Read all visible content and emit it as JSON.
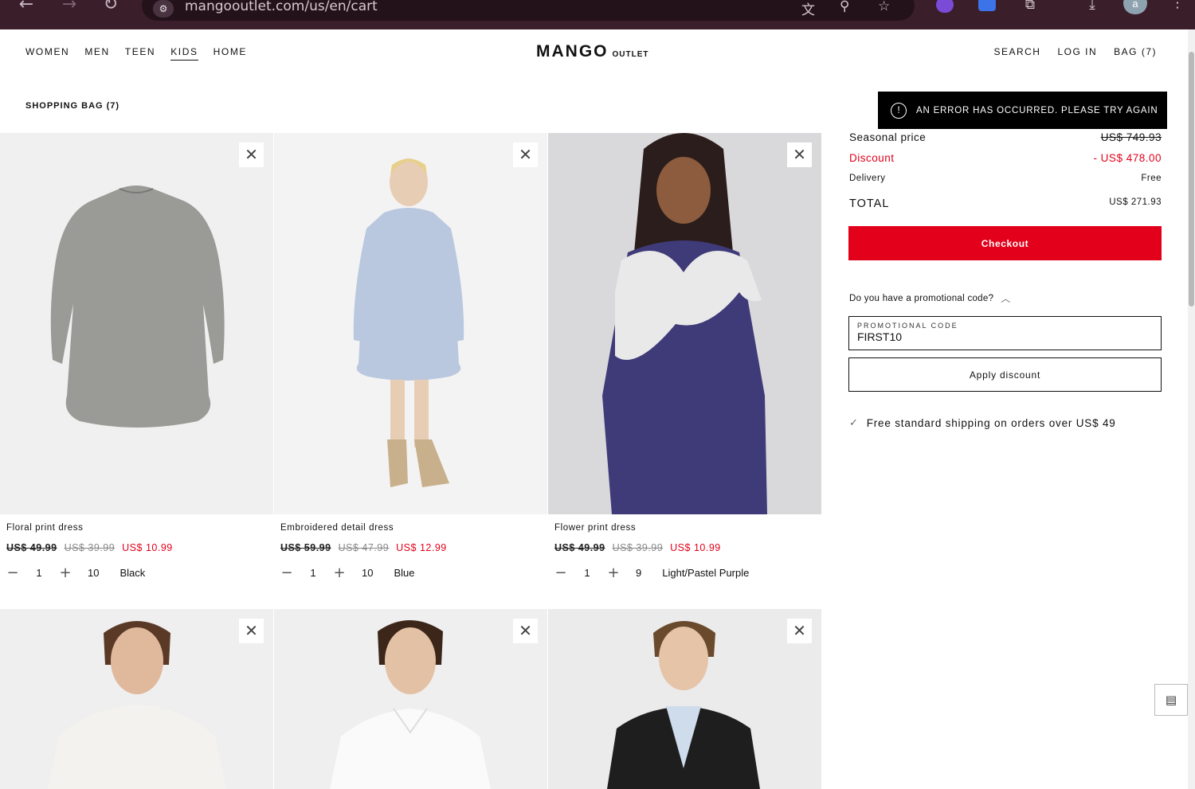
{
  "browser": {
    "url": "mangooutlet.com/us/en/cart"
  },
  "header": {
    "nav": [
      "WOMEN",
      "MEN",
      "TEEN",
      "KIDS",
      "HOME"
    ],
    "active_nav": "KIDS",
    "logo": "MANGO",
    "logo_sub": "OUTLET",
    "search": "SEARCH",
    "login": "LOG IN",
    "bag": "BAG (7)"
  },
  "page": {
    "title": "SHOPPING BAG (7)"
  },
  "toast": {
    "message": "AN ERROR HAS OCCURRED. PLEASE TRY AGAIN",
    "icon": "alert-circle-icon"
  },
  "products": [
    {
      "name": "Floral print dress",
      "original_price": "US$ 49.99",
      "previous_price": "US$ 39.99",
      "sale_price": "US$ 10.99",
      "quantity": "1",
      "size": "10",
      "color": "Black"
    },
    {
      "name": "Embroidered detail dress",
      "original_price": "US$ 59.99",
      "previous_price": "US$ 47.99",
      "sale_price": "US$ 12.99",
      "quantity": "1",
      "size": "10",
      "color": "Blue"
    },
    {
      "name": "Flower print dress",
      "original_price": "US$ 49.99",
      "previous_price": "US$ 39.99",
      "sale_price": "US$ 10.99",
      "quantity": "1",
      "size": "9",
      "color": "Light/Pastel Purple"
    },
    {
      "name": ""
    },
    {
      "name": ""
    },
    {
      "name": ""
    }
  ],
  "summary": {
    "seasonal_label": "Seasonal price",
    "seasonal_value": "US$ 749.93",
    "discount_label": "Discount",
    "discount_value": "- US$ 478.00",
    "delivery_label": "Delivery",
    "delivery_value": "Free",
    "total_label": "TOTAL",
    "total_value": "US$ 271.93",
    "checkout": "Checkout",
    "promo_question": "Do you have a promotional code?",
    "promo_label": "PROMOTIONAL CODE",
    "promo_value": "FIRST10",
    "apply": "Apply discount",
    "shipping_note": "Free standard shipping on orders over US$ 49"
  },
  "colors": {
    "accent_red": "#e2001a",
    "toast_bg": "#000000",
    "chrome_bg": "#3a1f2b"
  }
}
